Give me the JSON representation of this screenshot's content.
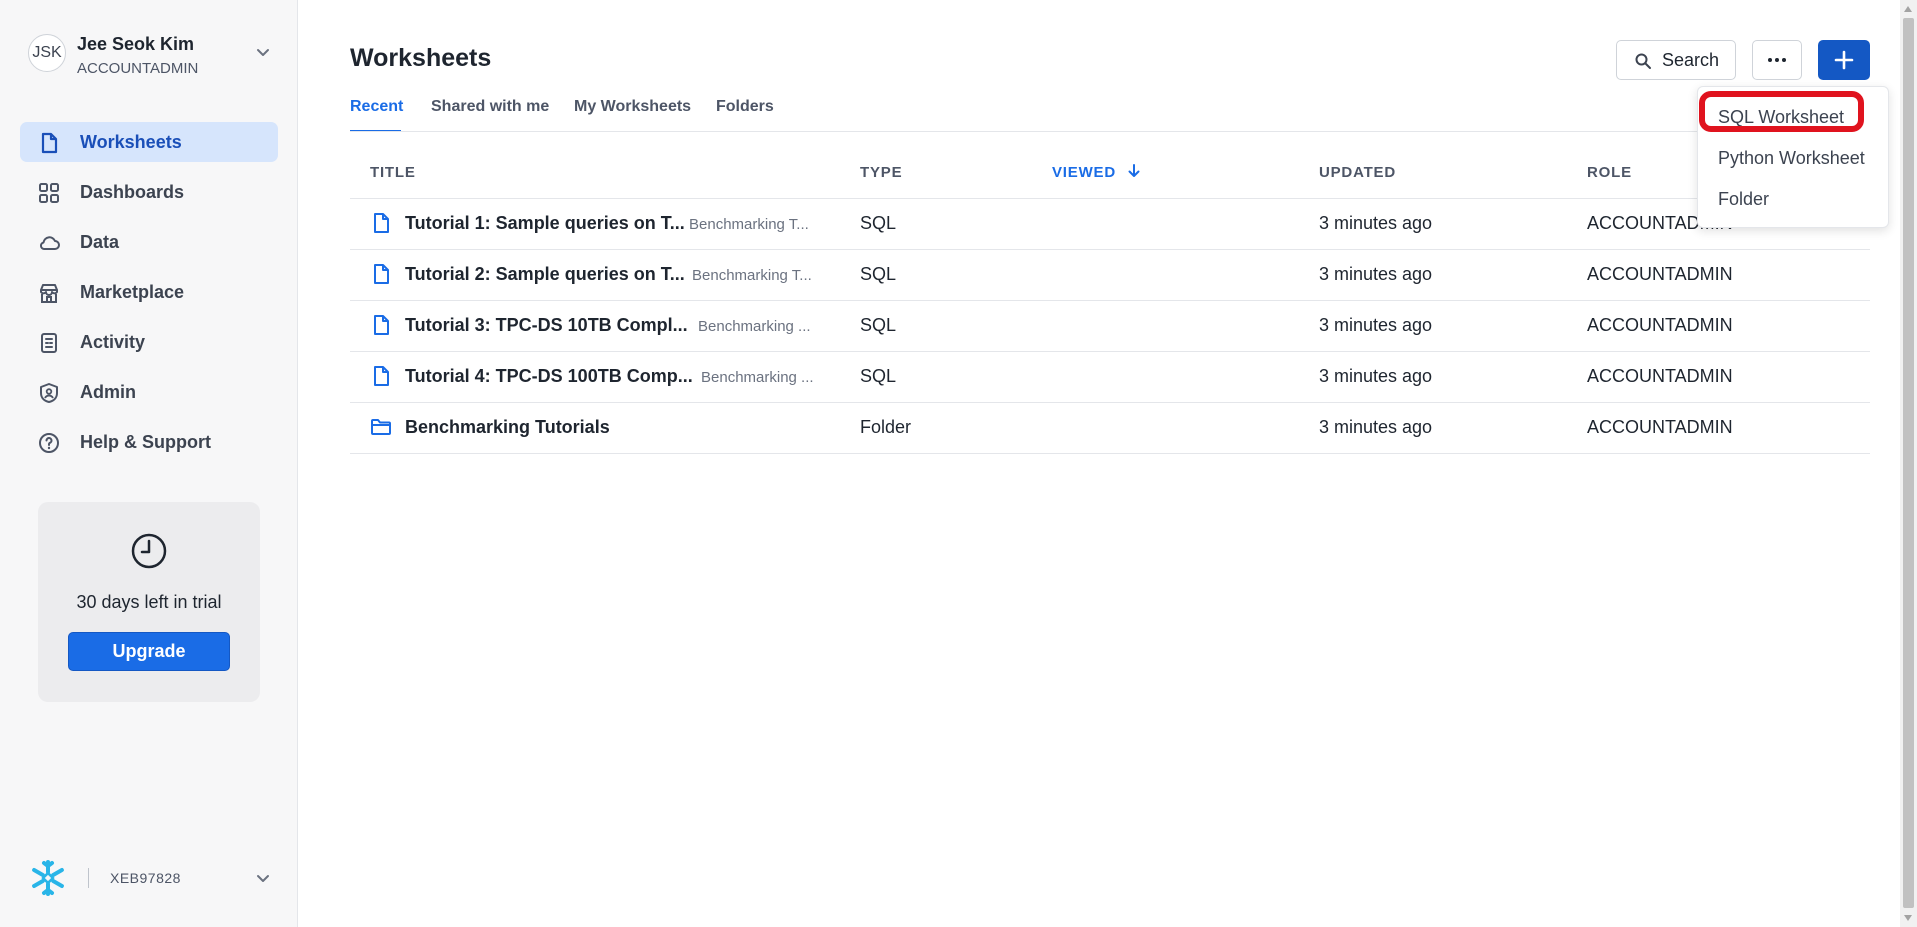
{
  "user": {
    "initials": "JSK",
    "name": "Jee Seok Kim",
    "role": "ACCOUNTADMIN"
  },
  "nav": {
    "items": [
      {
        "label": "Worksheets",
        "icon": "worksheet-icon",
        "active": true
      },
      {
        "label": "Dashboards",
        "icon": "dashboards-icon"
      },
      {
        "label": "Data",
        "icon": "cloud-icon"
      },
      {
        "label": "Marketplace",
        "icon": "store-icon"
      },
      {
        "label": "Activity",
        "icon": "activity-icon"
      },
      {
        "label": "Admin",
        "icon": "shield-icon"
      },
      {
        "label": "Help & Support",
        "icon": "help-icon"
      }
    ]
  },
  "trial": {
    "text": "30 days left in trial",
    "button": "Upgrade"
  },
  "footer": {
    "account_id": "XEB97828"
  },
  "header": {
    "title": "Worksheets",
    "search_label": "Search"
  },
  "tabs": [
    "Recent",
    "Shared with me",
    "My Worksheets",
    "Folders"
  ],
  "table": {
    "columns": [
      "TITLE",
      "TYPE",
      "VIEWED",
      "UPDATED",
      "ROLE"
    ],
    "rows": [
      {
        "title": "Tutorial 1: Sample queries on T...",
        "folder": "Benchmarking T...",
        "type": "SQL",
        "updated": "3 minutes ago",
        "role": "ACCOUNTADMIN",
        "kind": "file"
      },
      {
        "title": "Tutorial 2: Sample queries on T...",
        "folder": "Benchmarking T...",
        "type": "SQL",
        "updated": "3 minutes ago",
        "role": "ACCOUNTADMIN",
        "kind": "file"
      },
      {
        "title": "Tutorial 3: TPC-DS 10TB Compl...",
        "folder": "Benchmarking ...",
        "type": "SQL",
        "updated": "3 minutes ago",
        "role": "ACCOUNTADMIN",
        "kind": "file"
      },
      {
        "title": "Tutorial 4: TPC-DS 100TB Comp...",
        "folder": "Benchmarking ...",
        "type": "SQL",
        "updated": "3 minutes ago",
        "role": "ACCOUNTADMIN",
        "kind": "file"
      },
      {
        "title": "Benchmarking Tutorials",
        "folder": "",
        "type": "Folder",
        "updated": "3 minutes ago",
        "role": "ACCOUNTADMIN",
        "kind": "folder"
      }
    ]
  },
  "menu": {
    "items": [
      "SQL Worksheet",
      "Python Worksheet",
      "Folder"
    ]
  },
  "colors": {
    "accent": "#1a6ce6",
    "primary_button": "#1458c4",
    "highlight": "#e0131e"
  }
}
